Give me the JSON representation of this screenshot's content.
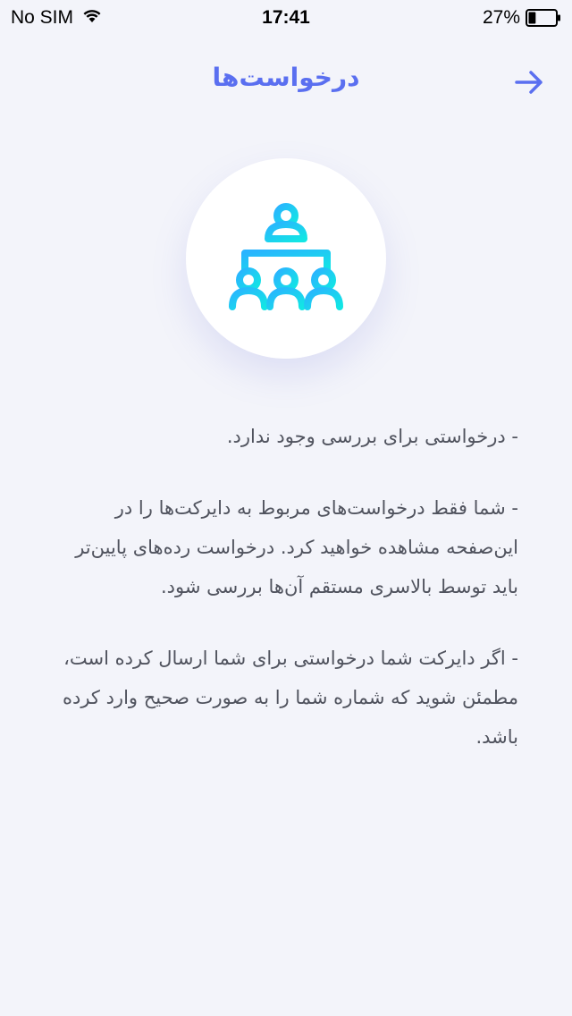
{
  "status_bar": {
    "carrier": "No SIM",
    "time": "17:41",
    "battery": "27%",
    "battery_level": 0.27
  },
  "header": {
    "title": "درخواست‌ها",
    "back_icon": "arrow-right-icon"
  },
  "hero": {
    "icon": "hierarchy-people-icon",
    "gradient_start": "#23c6f5",
    "gradient_end": "#16e0e8"
  },
  "content": {
    "paragraphs": [
      "- درخواستی برای بررسی وجود ندارد.",
      "- شما فقط درخواست‌های مربوط به دایرکت‌ها را در این‌صفحه مشاهده خواهید کرد. درخواست رده‌های پایین‌تر باید توسط بالاسری مستقم آن‌ها بررسی شود.",
      "- اگر دایرکت شما درخواستی برای شما ارسال کرده است، مطمئن شوید که شماره شما را به صورت صحیح وارد کرده باشد."
    ]
  },
  "colors": {
    "accent": "#5a6ff0",
    "background": "#f3f4fa",
    "text": "#50535e"
  }
}
